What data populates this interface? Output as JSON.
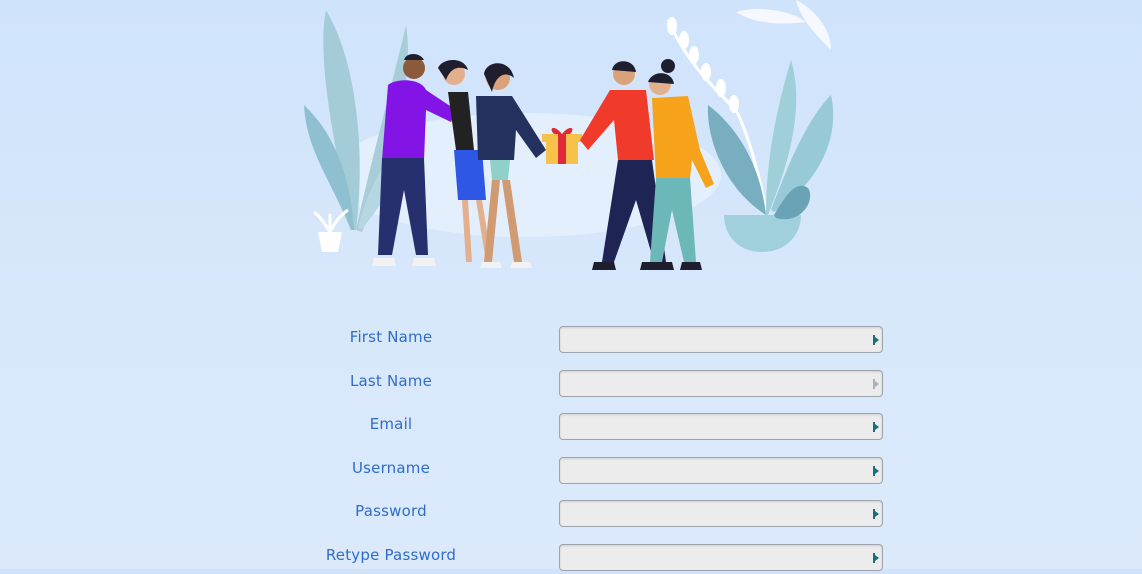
{
  "illustration": {
    "name": "people-exchanging-gift-illustration"
  },
  "form": {
    "fields": [
      {
        "label": "First Name",
        "value": "",
        "icon": "autofill-key-icon",
        "icon_active": true
      },
      {
        "label": "Last Name",
        "value": "",
        "icon": "autofill-key-icon",
        "icon_active": false
      },
      {
        "label": "Email",
        "value": "",
        "icon": "autofill-key-icon",
        "icon_active": true
      },
      {
        "label": "Username",
        "value": "",
        "icon": "autofill-key-icon",
        "icon_active": true
      },
      {
        "label": "Password",
        "value": "",
        "icon": "autofill-key-icon",
        "icon_active": true
      },
      {
        "label": "Retype Password",
        "value": "",
        "icon": "autofill-key-icon",
        "icon_active": true
      }
    ]
  },
  "colors": {
    "label": "#2f6cc9",
    "background": "#cfe3fb",
    "input_bg": "#ececec",
    "icon_active": "#1c6e7d",
    "icon_inactive": "#a9b2bb"
  }
}
